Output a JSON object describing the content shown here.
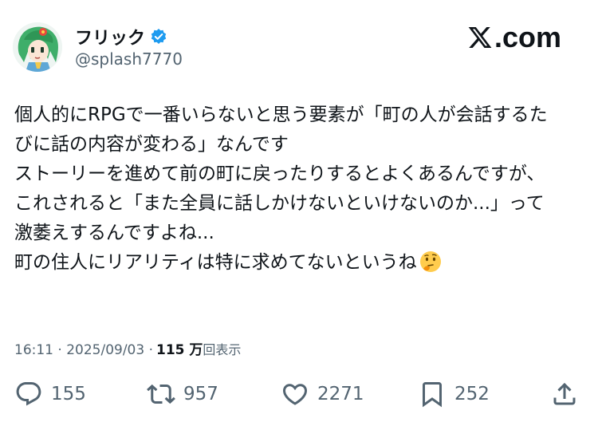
{
  "user": {
    "name": "フリック",
    "handle": "@splash7770"
  },
  "brand": {
    "logo_text": ".com",
    "logo_icon": "x-logo-icon"
  },
  "tweet": {
    "lines": [
      "個人的にRPGで一番いらないと思う要素が「町の人が会話するた",
      "びに話の内容が変わる」なんです",
      "ストーリーを進めて前の町に戻ったりするとよくあるんですが、",
      "これされると「また全員に話しかけないといけないのか...」って",
      "激萎えするんですよね...",
      "町の住人にリアリティは特に求めてないというね"
    ],
    "emoji": "thinking-face-icon"
  },
  "meta": {
    "timestamp": "16:11 · 2025/09/03 · ",
    "views_count": "115 万",
    "views_label": "回表示"
  },
  "actions": {
    "replies": "155",
    "retweets": "957",
    "likes": "2271",
    "bookmarks": "252"
  },
  "colors": {
    "text": "#0f1419",
    "secondary": "#536471",
    "verified": "#1d9bf0"
  }
}
